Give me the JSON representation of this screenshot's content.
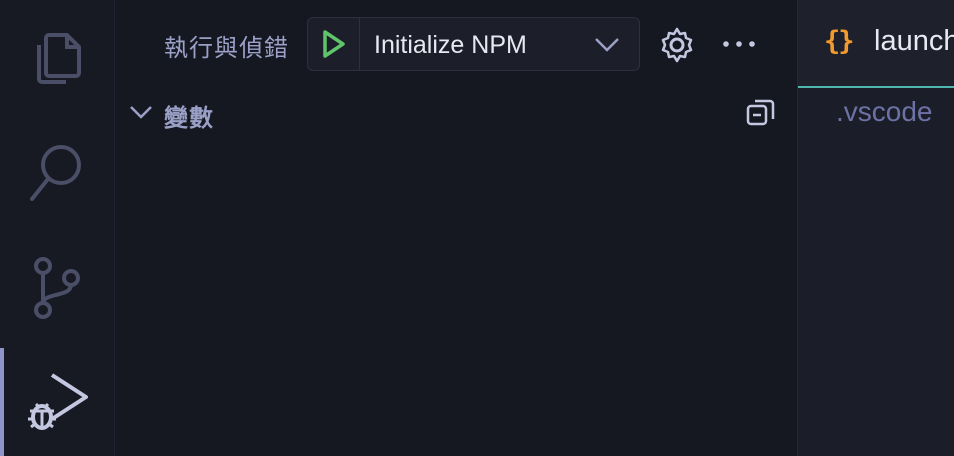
{
  "activity_bar": {
    "items": [
      {
        "icon": "files-icon",
        "active": false
      },
      {
        "icon": "search-icon",
        "active": false
      },
      {
        "icon": "source-control-icon",
        "active": false
      },
      {
        "icon": "run-debug-icon",
        "active": true
      }
    ]
  },
  "sidebar": {
    "title": "執行與偵錯",
    "launch_config": "Initialize NPM",
    "sections": [
      {
        "title": "變數",
        "expanded": true
      }
    ]
  },
  "editor": {
    "tab": {
      "icon": "{}",
      "label": "launch.json"
    },
    "breadcrumb": ".vscode"
  },
  "colors": {
    "accent": "#4fb7b0",
    "play": "#5fc46a",
    "json_icon": "#f29a2e"
  }
}
